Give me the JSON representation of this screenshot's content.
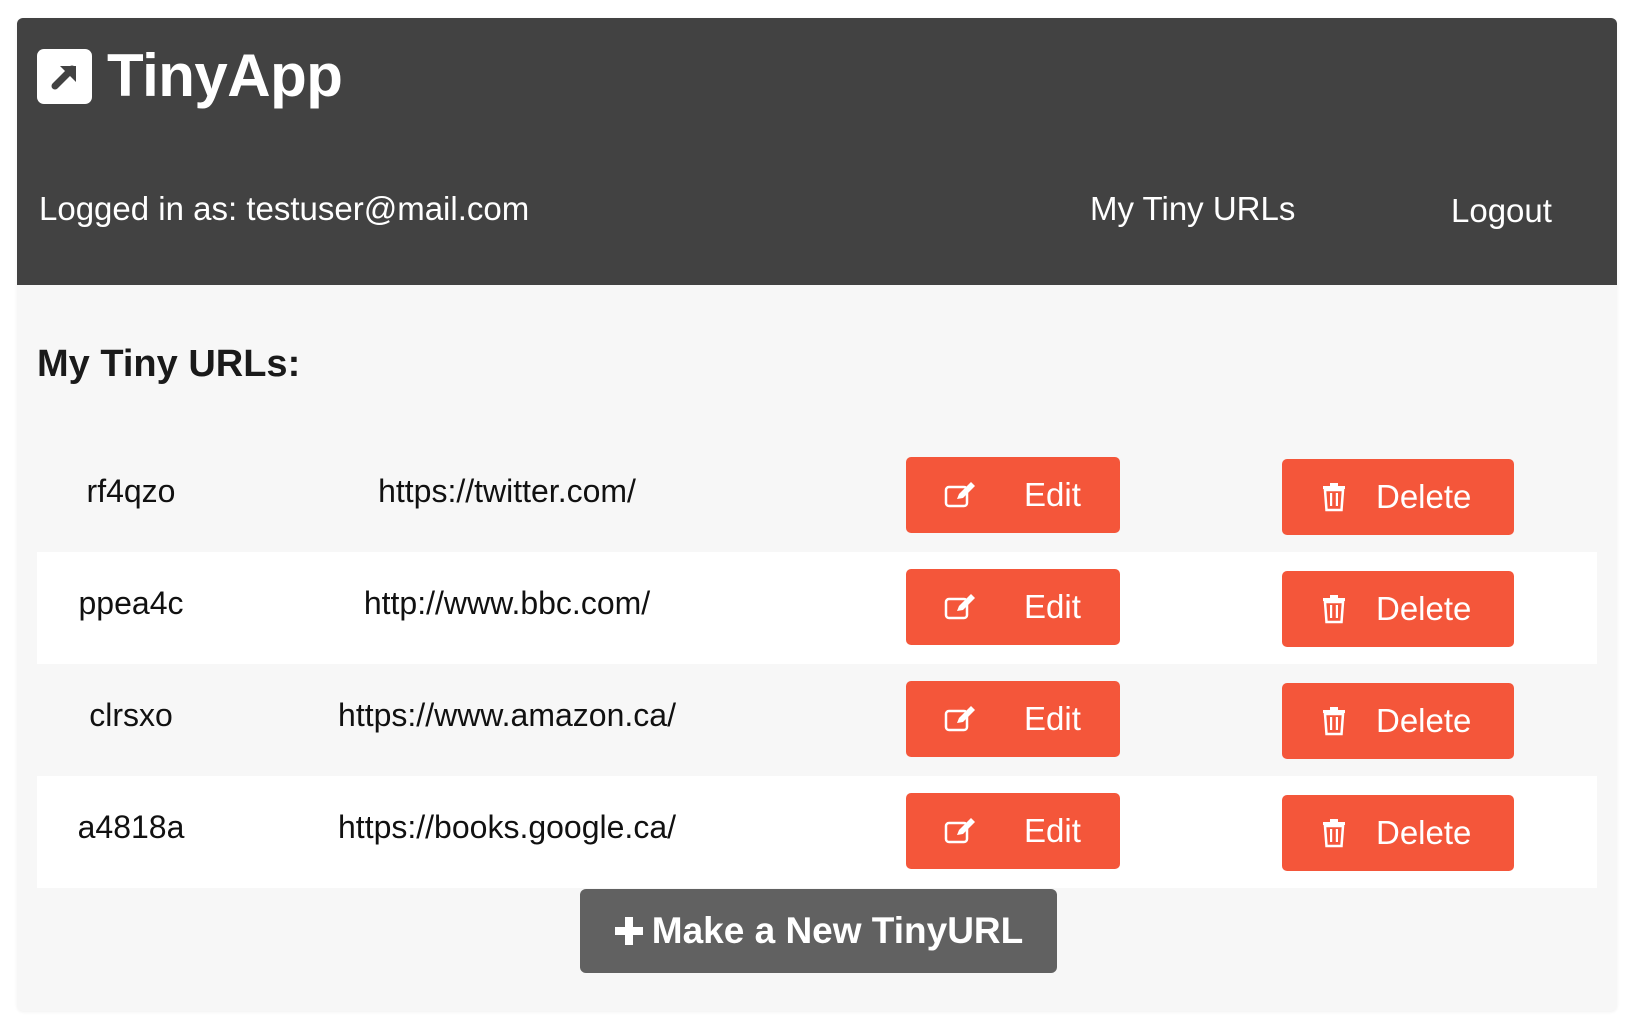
{
  "app": {
    "title": "TinyApp",
    "logo_icon": "external-link-arrow-icon",
    "colors": {
      "header": "#424242",
      "accent": "#f4563a",
      "new_button": "#616161",
      "background": "#f7f7f7"
    }
  },
  "header": {
    "logged_in_text": "Logged in as: testuser@mail.com",
    "nav": {
      "my_urls": "My Tiny URLs",
      "logout": "Logout"
    }
  },
  "main": {
    "section_title": "My Tiny URLs:",
    "edit_label": "Edit",
    "delete_label": "Delete",
    "edit_icon": "edit-icon",
    "delete_icon": "trash-icon",
    "urls": [
      {
        "short": "rf4qzo",
        "long": "https://twitter.com/"
      },
      {
        "short": "ppea4c",
        "long": "http://www.bbc.com/"
      },
      {
        "short": "clrsxo",
        "long": "https://www.amazon.ca/"
      },
      {
        "short": "a4818a",
        "long": "https://books.google.ca/"
      }
    ],
    "new_button": "Make a New TinyURL",
    "new_icon": "plus-icon"
  }
}
